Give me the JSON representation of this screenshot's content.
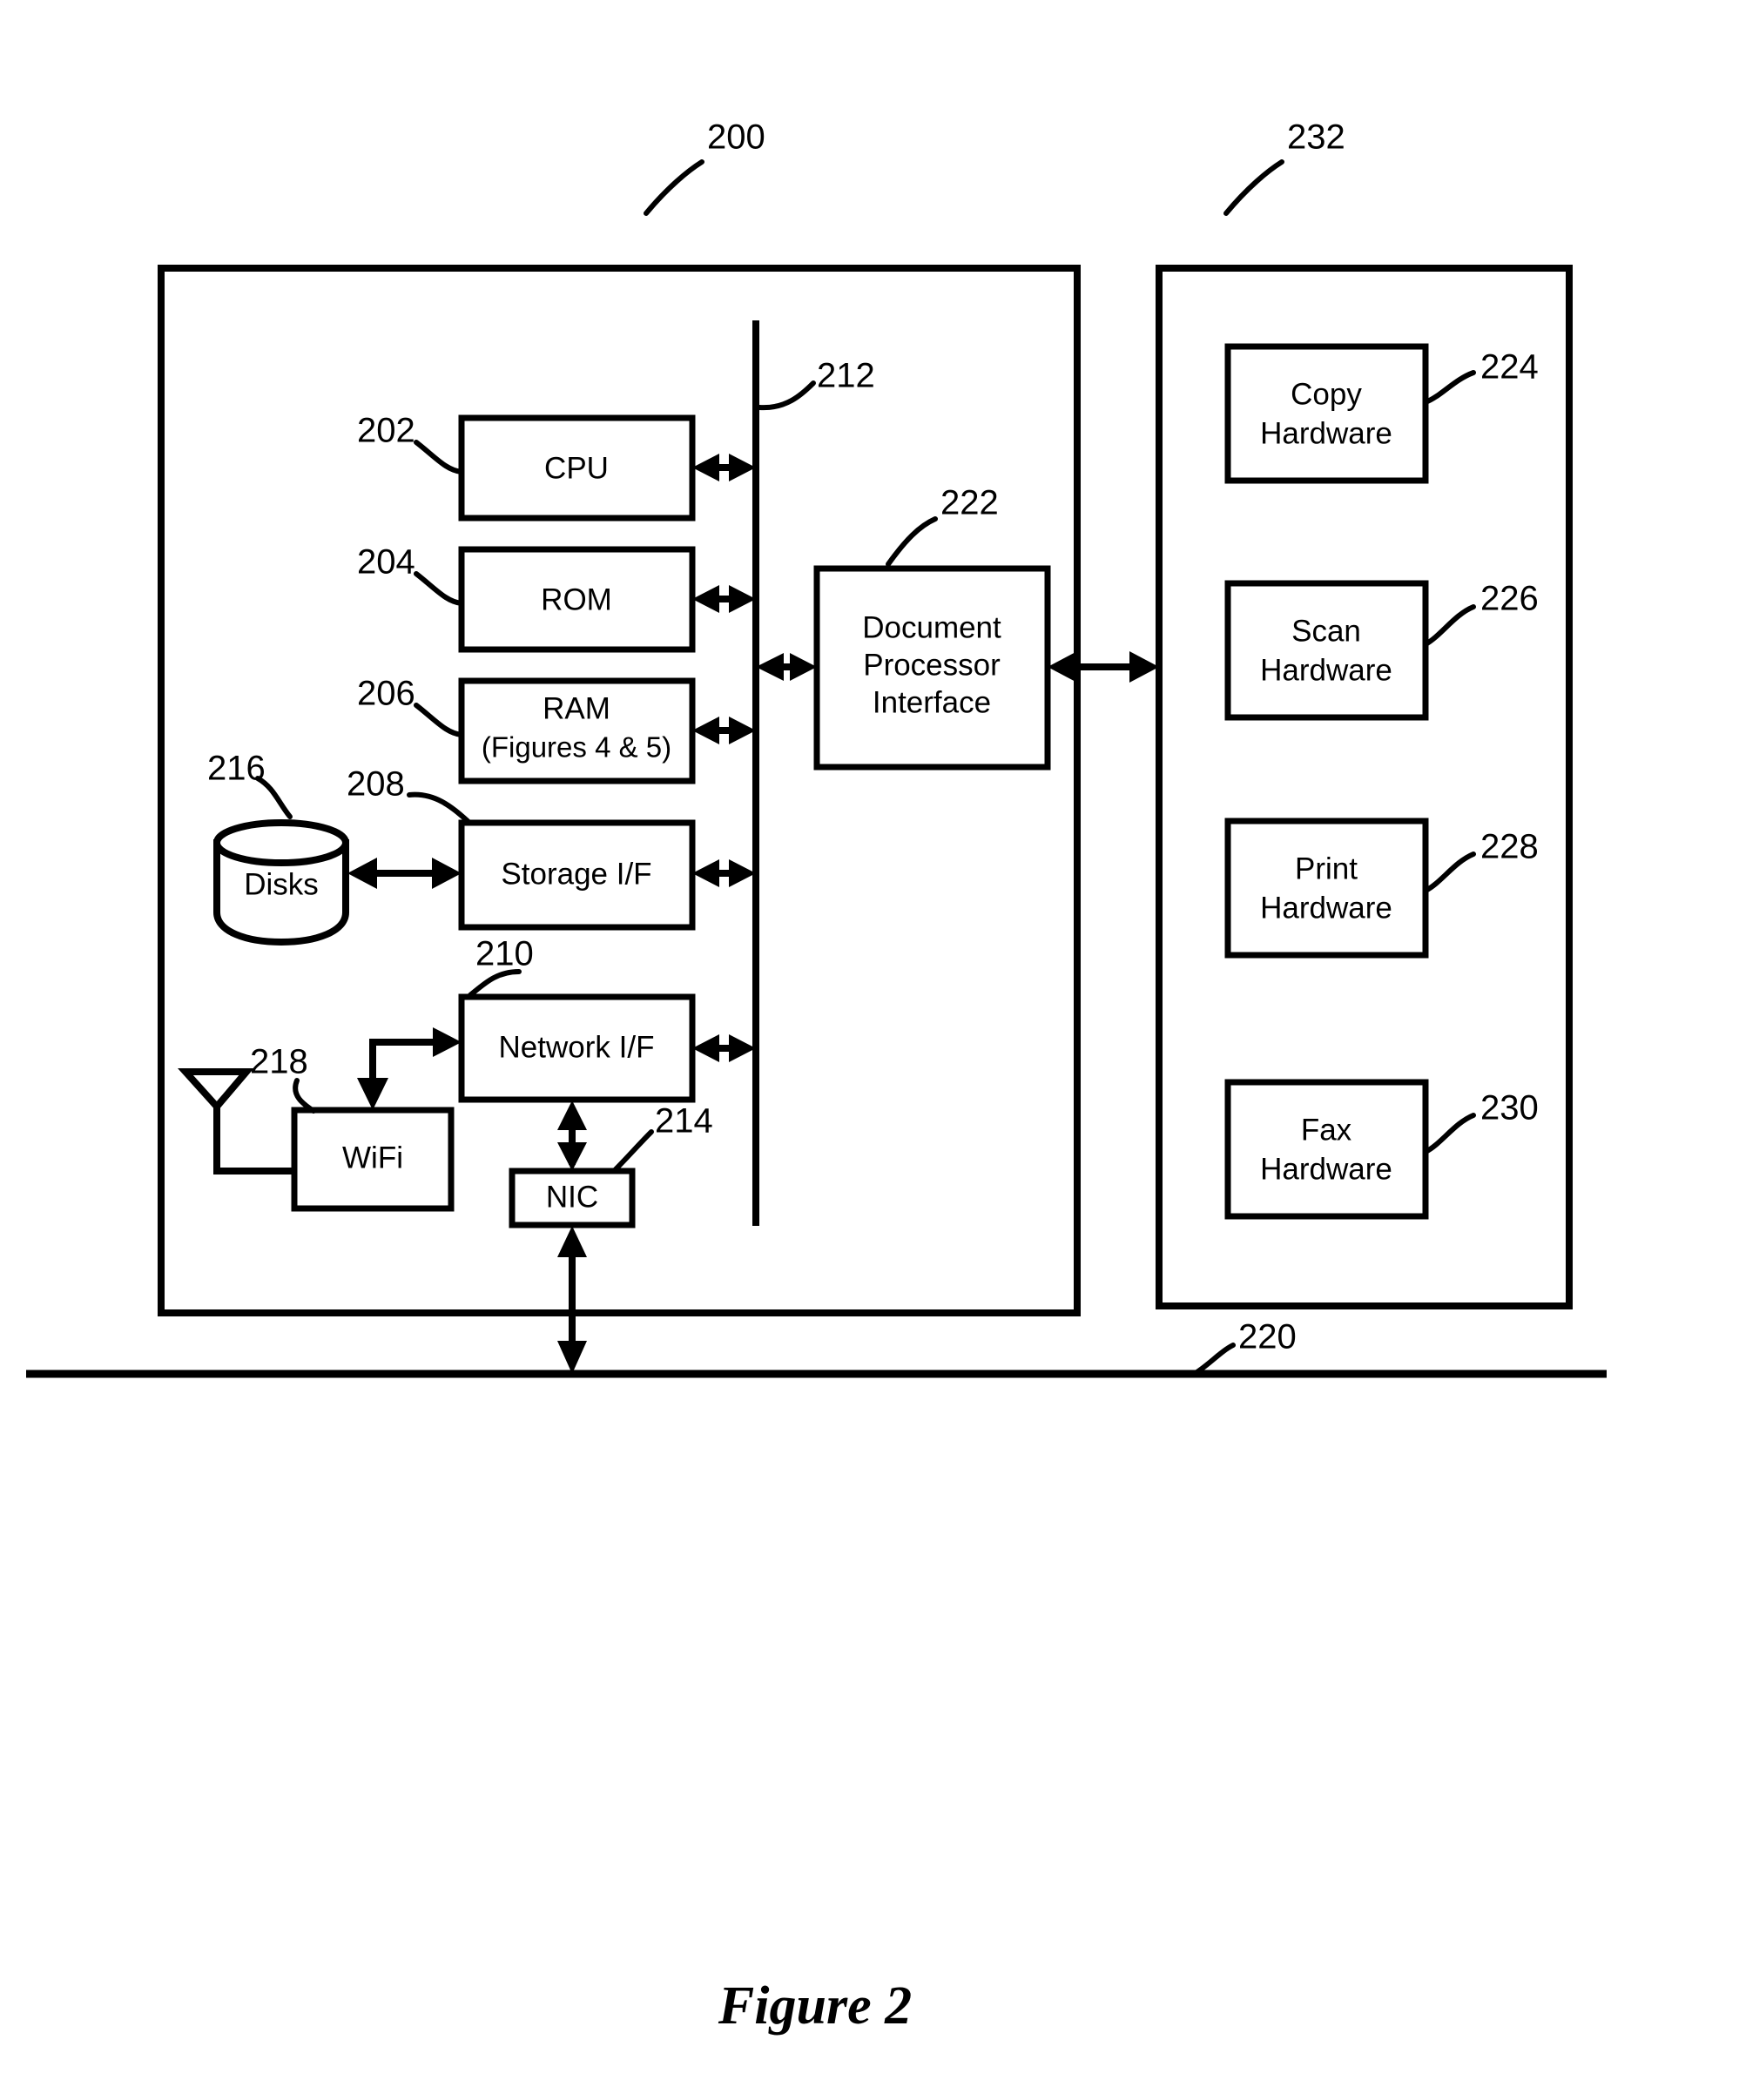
{
  "figure": {
    "caption": "Figure 2",
    "reference_numerals": {
      "system": "200",
      "cpu": "202",
      "rom": "204",
      "ram": "206",
      "storage_if": "208",
      "network_if": "210",
      "bus": "212",
      "nic": "214",
      "disks": "216",
      "antenna": "218",
      "network": "220",
      "document_processor_interface": "222",
      "copy_hardware": "224",
      "scan_hardware": "226",
      "print_hardware": "228",
      "fax_hardware": "230",
      "document_processor": "232"
    }
  },
  "blocks": {
    "cpu": {
      "label": "CPU",
      "ref": "202"
    },
    "rom": {
      "label": "ROM",
      "ref": "204"
    },
    "ram": {
      "line1": "RAM",
      "line2": "(Figures 4 & 5)",
      "ref": "206"
    },
    "storage_if": {
      "label": "Storage I/F",
      "ref": "208"
    },
    "network_if": {
      "label": "Network I/F",
      "ref": "210"
    },
    "nic": {
      "label": "NIC",
      "ref": "214"
    },
    "wifi": {
      "label": "WiFi"
    },
    "disks": {
      "label": "Disks",
      "ref": "216"
    },
    "dpi": {
      "line1": "Document",
      "line2": "Processor",
      "line3": "Interface",
      "ref": "222"
    },
    "copy_hw": {
      "line1": "Copy",
      "line2": "Hardware",
      "ref": "224"
    },
    "scan_hw": {
      "line1": "Scan",
      "line2": "Hardware",
      "ref": "226"
    },
    "print_hw": {
      "line1": "Print",
      "line2": "Hardware",
      "ref": "228"
    },
    "fax_hw": {
      "line1": "Fax",
      "line2": "Hardware",
      "ref": "230"
    }
  },
  "icons": {
    "disks": "cylinder-database-icon",
    "antenna": "antenna-icon",
    "bus": "vertical-bus-line",
    "network": "horizontal-network-line"
  },
  "colors": {
    "stroke": "#000000",
    "background": "#ffffff"
  }
}
